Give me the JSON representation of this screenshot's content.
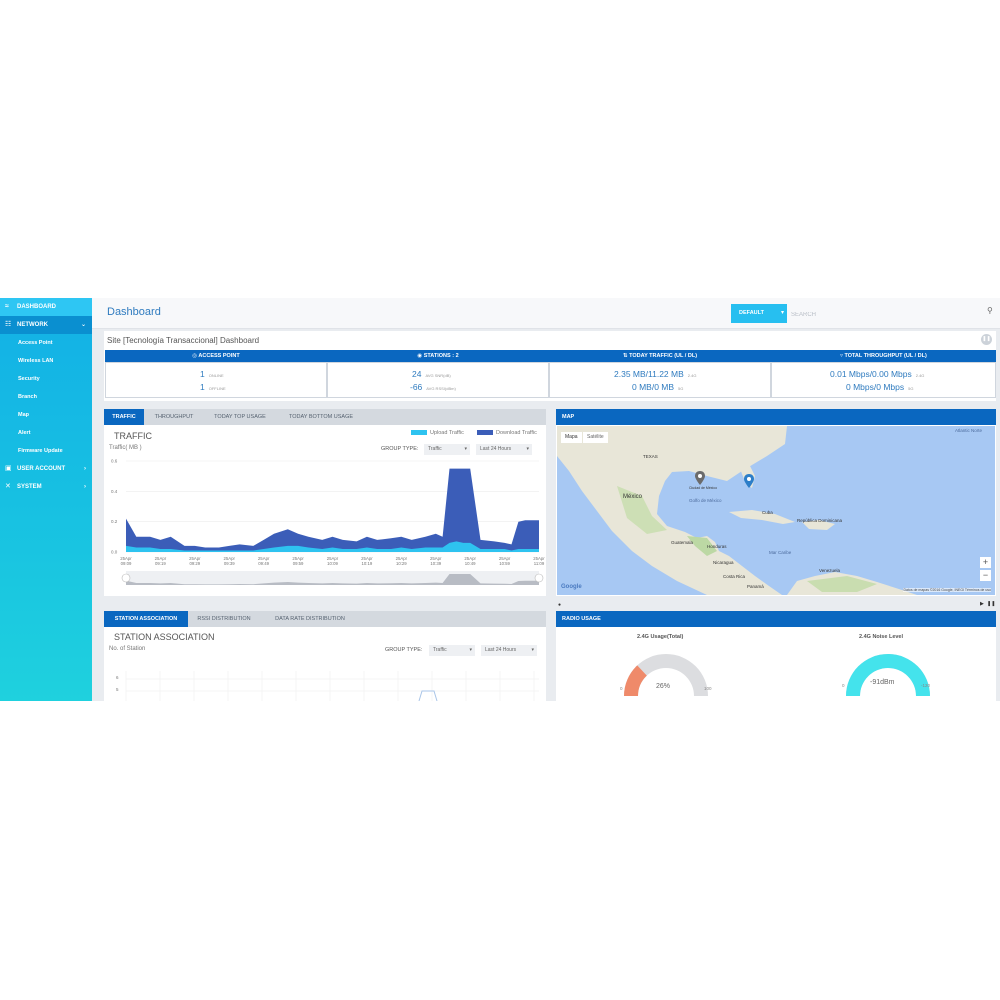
{
  "sidebar": {
    "items": [
      {
        "label": "DASHBOARD",
        "icon": "wifi-icon"
      },
      {
        "label": "NETWORK",
        "icon": "network-icon"
      },
      {
        "label": "USER ACCOUNT",
        "icon": "monitor-icon"
      },
      {
        "label": "SYSTEM",
        "icon": "wrench-icon"
      }
    ],
    "network_sub": [
      "Access Point",
      "Wireless LAN",
      "Security",
      "Branch",
      "Map",
      "Alert",
      "Firmware Update"
    ]
  },
  "header": {
    "title": "Dashboard",
    "default_label": "DEFAULT",
    "search_placeholder": "SEARCH"
  },
  "site": {
    "title": "Site [Tecnología Transaccional] Dashboard",
    "stats": [
      {
        "header": "ACCESS POINT",
        "rows": [
          {
            "value": "1",
            "label": "ONLINE"
          },
          {
            "value": "1",
            "label": "OFFLINE"
          }
        ]
      },
      {
        "header": "STATIONS : 2",
        "rows": [
          {
            "value": "24",
            "label": "AVG SNR(dB)"
          },
          {
            "value": "-66",
            "label": "AVG RSSI(dBm)"
          }
        ]
      },
      {
        "header": "TODAY TRAFFIC (UL / DL)",
        "rows": [
          {
            "value": "2.35 MB/11.22 MB",
            "label": "2.4G"
          },
          {
            "value": "0 MB/0 MB",
            "label": "5G"
          }
        ]
      },
      {
        "header": "TOTAL THROUGHPUT (UL / DL)",
        "rows": [
          {
            "value": "0.01 Mbps/0.00 Mbps",
            "label": "2.4G"
          },
          {
            "value": "0 Mbps/0 Mbps",
            "label": "5G"
          }
        ]
      }
    ]
  },
  "traffic": {
    "tabs": [
      "TRAFFIC",
      "THROUGHPUT",
      "TODAY TOP USAGE",
      "TODAY BOTTOM USAGE"
    ],
    "title": "TRAFFIC",
    "unit_label": "Traffic( MB )",
    "group_type_label": "GROUP TYPE:",
    "group_type_value": "Traffic",
    "range_value": "Last 24 Hours",
    "legend": [
      "Upload Traffic",
      "Download Traffic"
    ]
  },
  "chart_data": {
    "type": "area",
    "ylabel": "Traffic( MB )",
    "yticks": [
      "0.6",
      "0.4",
      "0.2",
      "0.0"
    ],
    "ylim": [
      0,
      0.6
    ],
    "x_labels": [
      "25Apr 09:09",
      "25Apr 09:19",
      "25Apr 09:29",
      "25Apr 09:39",
      "25Apr 09:49",
      "25Apr 09:59",
      "25Apr 10:09",
      "25Apr 10:19",
      "25Apr 10:29",
      "25Apr 10:39",
      "25Apr 10:49",
      "25Apr 10:59",
      "25Apr 11:09"
    ],
    "x": [
      0,
      0.3,
      0.7,
      1,
      1.3,
      1.7,
      2,
      2.3,
      2.7,
      3,
      3.3,
      3.7,
      4,
      4.3,
      4.7,
      5,
      5.3,
      5.7,
      6,
      6.3,
      6.7,
      7,
      7.3,
      7.7,
      8,
      8.3,
      8.7,
      9,
      9.2,
      9.4,
      9.6,
      9.8,
      10,
      10.3,
      10.7,
      11,
      11.2,
      11.4,
      11.6,
      11.8,
      12
    ],
    "series": [
      {
        "name": "Download Traffic",
        "color": "#3b5db8",
        "values": [
          0.22,
          0.1,
          0.1,
          0.08,
          0.1,
          0.04,
          0.04,
          0.03,
          0.03,
          0.04,
          0.05,
          0.04,
          0.08,
          0.12,
          0.15,
          0.12,
          0.1,
          0.08,
          0.1,
          0.08,
          0.07,
          0.1,
          0.08,
          0.09,
          0.1,
          0.08,
          0.1,
          0.12,
          0.1,
          0.55,
          0.55,
          0.55,
          0.55,
          0.08,
          0.07,
          0.06,
          0.05,
          0.2,
          0.21,
          0.21,
          0.21
        ]
      },
      {
        "name": "Upload Traffic",
        "color": "#2ec3f0",
        "values": [
          0.04,
          0.03,
          0.03,
          0.02,
          0.02,
          0.01,
          0.01,
          0.01,
          0.01,
          0.01,
          0.01,
          0.01,
          0.02,
          0.03,
          0.04,
          0.04,
          0.03,
          0.02,
          0.03,
          0.02,
          0.02,
          0.03,
          0.02,
          0.02,
          0.03,
          0.02,
          0.03,
          0.03,
          0.03,
          0.06,
          0.07,
          0.06,
          0.06,
          0.02,
          0.02,
          0.02,
          0.01,
          0.02,
          0.02,
          0.02,
          0.02
        ]
      }
    ]
  },
  "map": {
    "title": "MAP",
    "map_types": [
      "Mapa",
      "Satélite"
    ],
    "labels": [
      "TEXAS",
      "México",
      "Golfo de México",
      "Cuba",
      "República Dominicana",
      "Guatemala",
      "Honduras",
      "Nicaragua",
      "Costa Rica",
      "Panamá",
      "Venezuela",
      "Mar Caribe",
      "Atlantic Norte",
      "Ciudad de México"
    ],
    "attribution": "Datos de mapas ©2016 Google, INEGI   Términos de uso",
    "logo": "Google"
  },
  "station": {
    "tabs": [
      "STATION ASSOCIATION",
      "RSSI DISTRIBUTION",
      "DATA RATE DISTRIBUTION"
    ],
    "title": "STATION ASSOCIATION",
    "unit_label": "No. of Station",
    "group_type_label": "GROUP TYPE:",
    "group_type_value": "Traffic",
    "range_value": "Last 24 Hours",
    "yticks": [
      "6",
      "5"
    ]
  },
  "radio": {
    "title": "RADIO USAGE",
    "gauges": [
      {
        "label": "2.4G Usage(Total)",
        "value_text": "26%",
        "value": 26,
        "min": "0",
        "max": "100",
        "color": "#ef8a6a"
      },
      {
        "label": "2.4G Noise Level",
        "value_text": "-91dBm",
        "min": "0",
        "max": "-120",
        "color": "#44e3ec"
      }
    ]
  }
}
